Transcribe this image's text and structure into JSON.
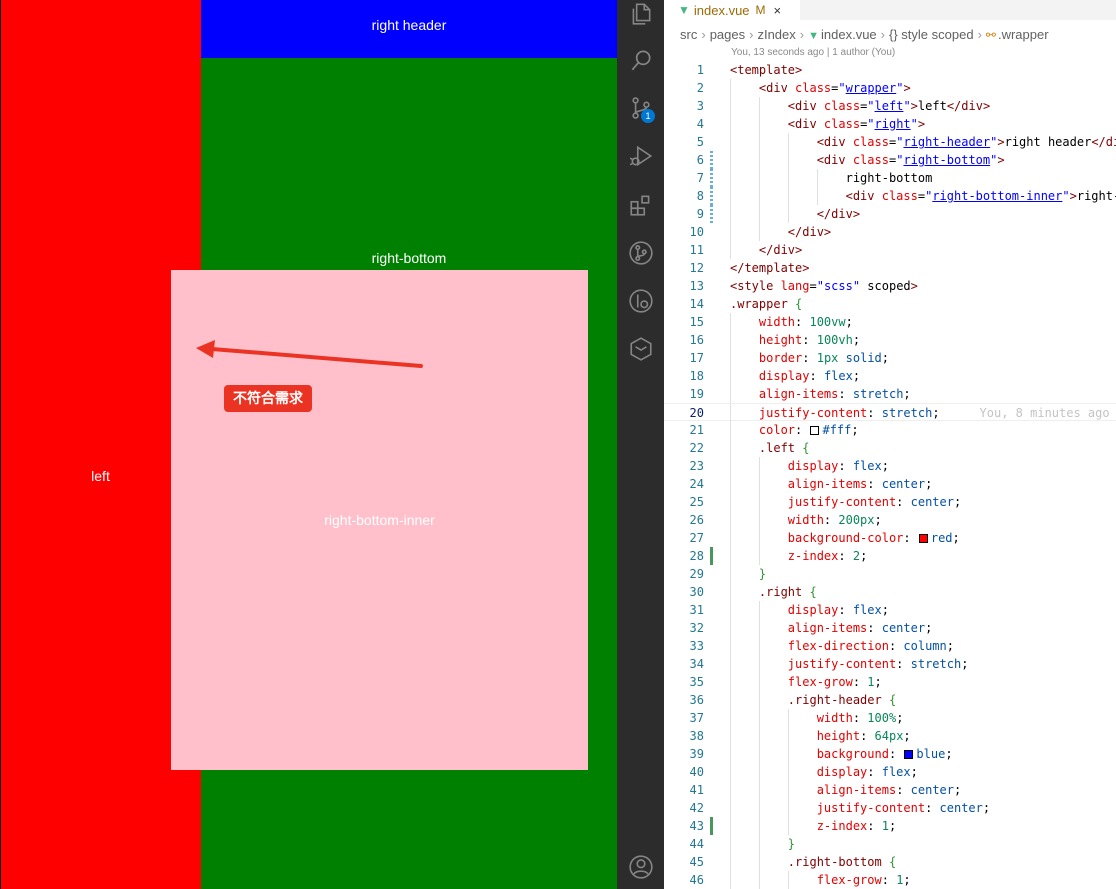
{
  "preview": {
    "left_label": "left",
    "header_label": "right header",
    "bottom_label": "right-bottom",
    "inner_label": "right-bottom-inner",
    "annotation": "不符合需求",
    "colors": {
      "left": "#ff0000",
      "header": "#0000ff",
      "bottom": "#008000",
      "inner": "#ffc0cb",
      "annotation": "#ea3323"
    }
  },
  "activity_bar": {
    "icons": [
      "explorer-icon",
      "search-icon",
      "source-control-icon",
      "run-debug-icon",
      "extensions-icon",
      "git-graph-icon",
      "gitlens-icon",
      "remote-explorer-icon",
      "accounts-icon"
    ],
    "scm_badge": "1"
  },
  "editor": {
    "tab": {
      "name": "index.vue",
      "status": "M",
      "close": "×"
    },
    "breadcrumb": [
      "src",
      "pages",
      "zIndex",
      "index.vue",
      "{} style scoped",
      ".wrapper"
    ],
    "blame_lens": "You, 13 seconds ago | 1 author (You)",
    "current_line_blame": "You, 8 minutes ago",
    "swatch_colors": {
      "fff": "#ffffff",
      "red": "#ff0000",
      "blue": "#0000ff"
    },
    "lines": [
      {
        "n": "1",
        "t": "<template>"
      },
      {
        "n": "2",
        "t": "    <div class=\"wrapper\">"
      },
      {
        "n": "3",
        "t": "        <div class=\"left\">left</div>"
      },
      {
        "n": "4",
        "t": "        <div class=\"right\">"
      },
      {
        "n": "5",
        "t": "            <div class=\"right-header\">right header</div>"
      },
      {
        "n": "6",
        "t": "            <div class=\"right-bottom\">"
      },
      {
        "n": "7",
        "t": "                right-bottom"
      },
      {
        "n": "8",
        "t": "                <div class=\"right-bottom-inner\">right-bottom-inner</div>"
      },
      {
        "n": "9",
        "t": "            </div>"
      },
      {
        "n": "10",
        "t": "        </div>"
      },
      {
        "n": "11",
        "t": "    </div>"
      },
      {
        "n": "12",
        "t": "</template>"
      },
      {
        "n": "13",
        "t": "<style lang=\"scss\" scoped>"
      },
      {
        "n": "14",
        "t": ".wrapper {"
      },
      {
        "n": "15",
        "t": "    width: 100vw;"
      },
      {
        "n": "16",
        "t": "    height: 100vh;"
      },
      {
        "n": "17",
        "t": "    border: 1px solid;"
      },
      {
        "n": "18",
        "t": "    display: flex;"
      },
      {
        "n": "19",
        "t": "    align-items: stretch;"
      },
      {
        "n": "20",
        "t": "    justify-content: stretch;"
      },
      {
        "n": "21",
        "t": "    color: #fff;"
      },
      {
        "n": "22",
        "t": "    .left {"
      },
      {
        "n": "23",
        "t": "        display: flex;"
      },
      {
        "n": "24",
        "t": "        align-items: center;"
      },
      {
        "n": "25",
        "t": "        justify-content: center;"
      },
      {
        "n": "26",
        "t": "        width: 200px;"
      },
      {
        "n": "27",
        "t": "        background-color: red;"
      },
      {
        "n": "28",
        "t": "        z-index: 2;"
      },
      {
        "n": "29",
        "t": "    }"
      },
      {
        "n": "30",
        "t": "    .right {"
      },
      {
        "n": "31",
        "t": "        display: flex;"
      },
      {
        "n": "32",
        "t": "        align-items: center;"
      },
      {
        "n": "33",
        "t": "        flex-direction: column;"
      },
      {
        "n": "34",
        "t": "        justify-content: stretch;"
      },
      {
        "n": "35",
        "t": "        flex-grow: 1;"
      },
      {
        "n": "36",
        "t": "        .right-header {"
      },
      {
        "n": "37",
        "t": "            width: 100%;"
      },
      {
        "n": "38",
        "t": "            height: 64px;"
      },
      {
        "n": "39",
        "t": "            background: blue;"
      },
      {
        "n": "40",
        "t": "            display: flex;"
      },
      {
        "n": "41",
        "t": "            align-items: center;"
      },
      {
        "n": "42",
        "t": "            justify-content: center;"
      },
      {
        "n": "43",
        "t": "            z-index: 1;"
      },
      {
        "n": "44",
        "t": "        }"
      },
      {
        "n": "45",
        "t": "        .right-bottom {"
      },
      {
        "n": "46",
        "t": "            flex-grow: 1;"
      }
    ]
  }
}
